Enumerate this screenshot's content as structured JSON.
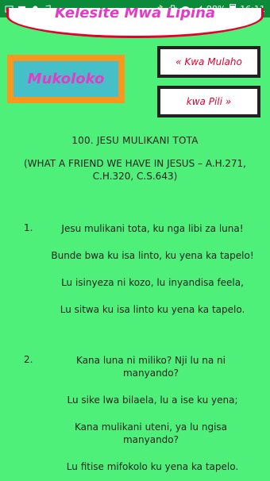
{
  "status_bar": {
    "battery": "98%",
    "time": "16:11",
    "left_icons": [
      "image-icon",
      "message-icon",
      "cloud-icon",
      "music-icon",
      "dots-icon"
    ],
    "right_icons": [
      "bluetooth-icon",
      "vibrate-icon",
      "wifi-icon",
      "signal-icon",
      "battery-icon"
    ]
  },
  "header": {
    "title": "Kelesite Mwa Lipina"
  },
  "mukoloko": {
    "label": "Mukoloko"
  },
  "nav": {
    "prev_label": "« Kwa Mulaho",
    "next_label": "kwa Pili »"
  },
  "song": {
    "title": "100. JESU MULIKANI TOTA",
    "reference": "(WHAT A FRIEND WE HAVE IN JESUS – A.H.271, C.H.320, C.S.643)",
    "verses": [
      {
        "number": "1.",
        "lines": [
          "Jesu mulikani tota, ku nga libi za luna!",
          "Bunde bwa ku isa linto, ku yena ka tapelo!",
          "Lu isinyeza ni kozo, lu inyandisa feela,",
          "Lu sitwa ku isa linto ku yena ka tapelo."
        ]
      },
      {
        "number": "2.",
        "lines": [
          "Kana luna ni miliko? Nji lu na ni manyando?",
          "Lu sike lwa bilaela, lu a ise ku yena;",
          "Kana mulikani uteni, ya lu ngisa manyando?",
          "Lu fitise mifokolo ku yena ka tapelo."
        ]
      }
    ]
  }
}
